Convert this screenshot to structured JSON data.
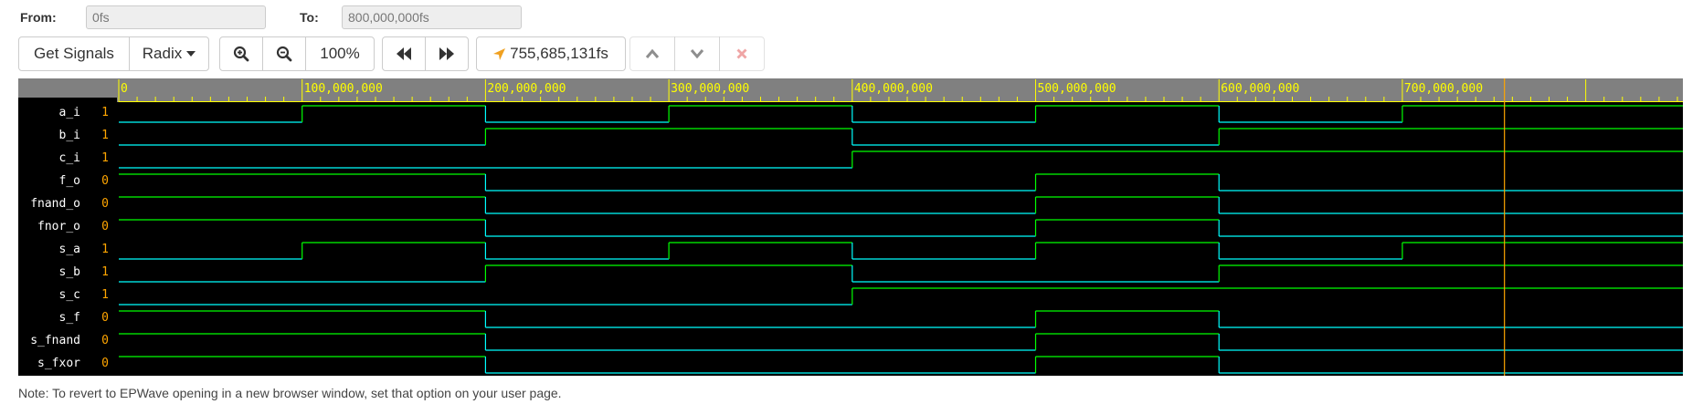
{
  "range": {
    "from_label": "From:",
    "from_value": "0fs",
    "to_label": "To:",
    "to_value": "800,000,000fs"
  },
  "toolbar": {
    "get_signals_label": "Get Signals",
    "radix_label": "Radix",
    "zoom_in_icon": "zoom-in-icon",
    "zoom_out_icon": "zoom-out-icon",
    "zoom_level": "100%",
    "prev_icon": "rewind-icon",
    "next_icon": "fast-forward-icon",
    "cursor_time": "755,685,131fs",
    "cursor_icon": "location-arrow-icon",
    "up_icon": "chevron-up-icon",
    "down_icon": "chevron-down-icon",
    "remove_icon": "close-icon"
  },
  "colors": {
    "toolbar_bg": "#ffffff",
    "wave_bg": "#000000",
    "ruler_bg": "#808080",
    "ruler_text": "#ffff00",
    "signal_name": "#ffffff",
    "signal_value": "#ffa500",
    "wave_high": "#00ff00",
    "wave_low": "#00ffff",
    "cursor": "#ffa500",
    "remove_icon": "#e35d5d"
  },
  "timeline": {
    "start": 0,
    "end": 853000000,
    "cursor": 755685131,
    "major_tick_step": 100000000,
    "minor_ticks_per_major": 10,
    "tick_labels": [
      "0",
      "100,000,000",
      "200,000,000",
      "300,000,000",
      "400,000,000",
      "500,000,000",
      "600,000,000",
      "700,000,000"
    ]
  },
  "signals": [
    {
      "name": "a_i",
      "value": "1",
      "initial": 0,
      "toggles": [
        100000000,
        200000000,
        300000000,
        400000000,
        500000000,
        600000000,
        700000000
      ]
    },
    {
      "name": "b_i",
      "value": "1",
      "initial": 0,
      "toggles": [
        200000000,
        400000000,
        600000000
      ]
    },
    {
      "name": "c_i",
      "value": "1",
      "initial": 0,
      "toggles": [
        400000000
      ]
    },
    {
      "name": "f_o",
      "value": "0",
      "initial": 1,
      "toggles": [
        200000000,
        500000000,
        600000000
      ]
    },
    {
      "name": "fnand_o",
      "value": "0",
      "initial": 1,
      "toggles": [
        200000000,
        500000000,
        600000000
      ]
    },
    {
      "name": "fnor_o",
      "value": "0",
      "initial": 1,
      "toggles": [
        200000000,
        500000000,
        600000000
      ]
    },
    {
      "name": "s_a",
      "value": "1",
      "initial": 0,
      "toggles": [
        100000000,
        200000000,
        300000000,
        400000000,
        500000000,
        600000000,
        700000000
      ]
    },
    {
      "name": "s_b",
      "value": "1",
      "initial": 0,
      "toggles": [
        200000000,
        400000000,
        600000000
      ]
    },
    {
      "name": "s_c",
      "value": "1",
      "initial": 0,
      "toggles": [
        400000000
      ]
    },
    {
      "name": "s_f",
      "value": "0",
      "initial": 1,
      "toggles": [
        200000000,
        500000000,
        600000000
      ]
    },
    {
      "name": "s_fnand",
      "value": "0",
      "initial": 1,
      "toggles": [
        200000000,
        500000000,
        600000000
      ]
    },
    {
      "name": "s_fxor",
      "value": "0",
      "initial": 1,
      "toggles": [
        200000000,
        500000000,
        600000000
      ]
    }
  ],
  "note": "Note: To revert to EPWave opening in a new browser window, set that option on your user page."
}
